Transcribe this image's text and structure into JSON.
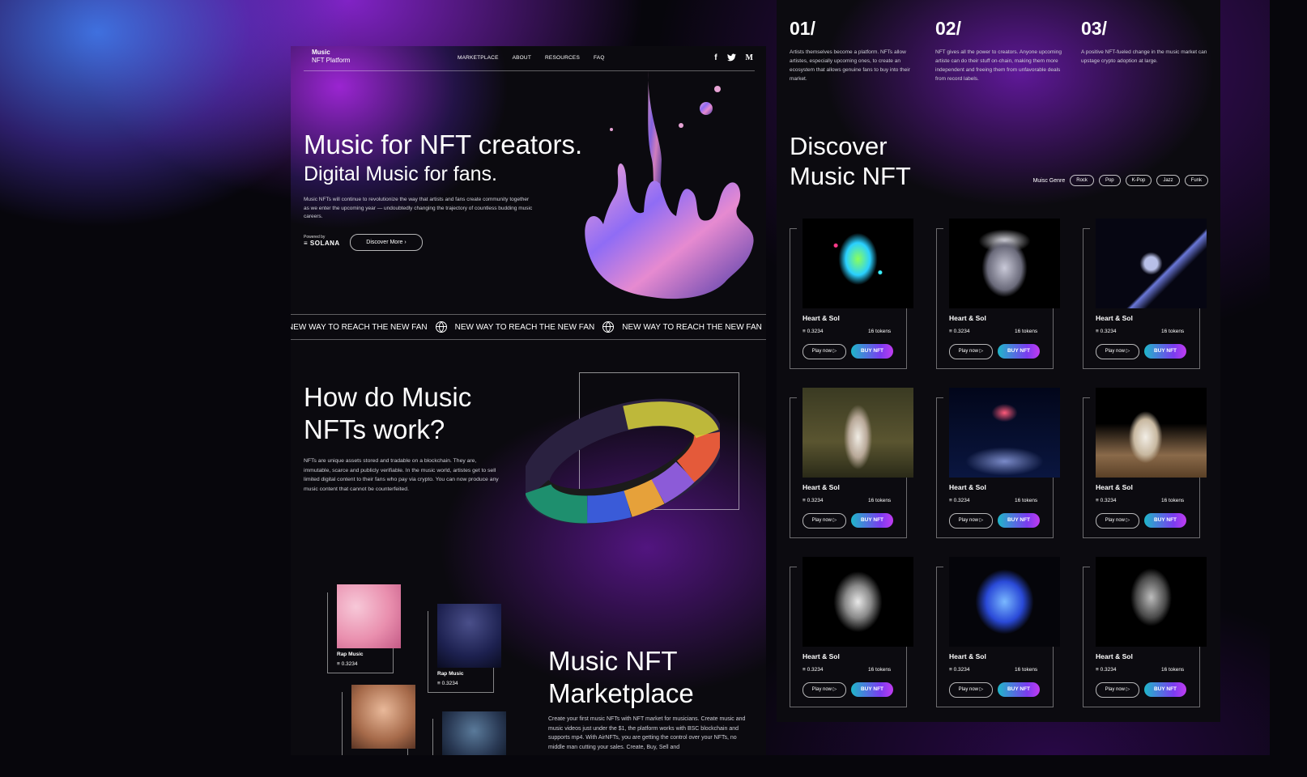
{
  "nav": {
    "logo_line1": "Music",
    "logo_line2": "NFT Platform",
    "links": [
      "MARKETPLACE",
      "ABOUT",
      "RESOURCES",
      "FAQ"
    ],
    "socials": [
      "f",
      "t",
      "M"
    ],
    "social_icons": [
      "facebook-icon",
      "twitter-icon",
      "medium-icon"
    ]
  },
  "hero": {
    "title": "Music for NFT creators.",
    "subtitle": "Digital Music for fans.",
    "description": "Music NFTs will continue to revolutionize the way that artists and fans create community together as we enter the upcoming year — undoubtedly changing the trajectory of countless budding music careers.",
    "powered_by": "Powered by",
    "solana": "≡ SOLANA",
    "cta": "Discover More  ›"
  },
  "marquee": {
    "text": "NEW WAY TO REACH THE NEW FAN"
  },
  "how": {
    "title": "How do Music NFTs work?",
    "description": "NFTs are unique assets stored and tradable on a blockchain. They are, immutable, scarce and publicly verifiable. In the music world, artistes get to sell limited digital content to their fans who pay via crypto. You can now produce any music content that cannot be counterfeited."
  },
  "artists": [
    {
      "name": "Rap Music",
      "price": "≡ 0.3234"
    },
    {
      "name": "Rap Music",
      "price": "≡ 0.3234"
    }
  ],
  "marketplace": {
    "title_line1": "Music NFT",
    "title_line2": "Marketplace",
    "description": "Create your first music NFTs with NFT market for musicians. Create music and music videos just under the $1, the platform works with BSC blockchain and supports mp4. With AirNFTs, you are getting the control over your NFTs, no middle man cutting your sales. Create, Buy, Sell and"
  },
  "steps": [
    {
      "num": "01/",
      "text": "Artists themselves become a platform. NFTs allow artistes, especially upcoming ones, to create an ecosystem that allows genuine fans to buy into their market."
    },
    {
      "num": "02/",
      "text": "NFT gives all the power to creators. Anyone upcoming artiste can do their stuff on-chain, making them more independent and freeing them from unfavorable deals from record labels."
    },
    {
      "num": "03/",
      "text": "A positive NFT-fueled change in the music market can upstage crypto adoption at large."
    }
  ],
  "discover": {
    "title_line1": "Discover",
    "title_line2": "Music NFT",
    "genre_label": "Muisc Genre",
    "genres": [
      "Rock",
      "Pop",
      "K-Pop",
      "Jazz",
      "Funk"
    ]
  },
  "nfts": [
    {
      "title": "Heart & Sol",
      "price": "≡ 0.3234",
      "tokens": "16 tokens",
      "play": "Play now ▷",
      "buy": "BUY NFT",
      "art": "astronaut-glitter"
    },
    {
      "title": "Heart & Sol",
      "price": "≡ 0.3234",
      "tokens": "16 tokens",
      "play": "Play now ▷",
      "buy": "BUY NFT",
      "art": "chrome-head-cap"
    },
    {
      "title": "Heart & Sol",
      "price": "≡ 0.3234",
      "tokens": "16 tokens",
      "play": "Play now ▷",
      "buy": "BUY NFT",
      "art": "hands-heart"
    },
    {
      "title": "Heart & Sol",
      "price": "≡ 0.3234",
      "tokens": "16 tokens",
      "play": "Play now ▷",
      "buy": "BUY NFT",
      "art": "astronaut-forest"
    },
    {
      "title": "Heart & Sol",
      "price": "≡ 0.3234",
      "tokens": "16 tokens",
      "play": "Play now ▷",
      "buy": "BUY NFT",
      "art": "floating-jellyfish"
    },
    {
      "title": "Heart & Sol",
      "price": "≡ 0.3234",
      "tokens": "16 tokens",
      "play": "Play now ▷",
      "buy": "BUY NFT",
      "art": "astronaut-chair"
    },
    {
      "title": "Heart & Sol",
      "price": "≡ 0.3234",
      "tokens": "16 tokens",
      "play": "Play now ▷",
      "buy": "BUY NFT",
      "art": "chrome-hand"
    },
    {
      "title": "Heart & Sol",
      "price": "≡ 0.3234",
      "tokens": "16 tokens",
      "play": "Play now ▷",
      "buy": "BUY NFT",
      "art": "blue-flower-bust"
    },
    {
      "title": "Heart & Sol",
      "price": "≡ 0.3234",
      "tokens": "16 tokens",
      "play": "Play now ▷",
      "buy": "BUY NFT",
      "art": "mesh-head"
    }
  ],
  "colors": {
    "accent_purple": "#7a3cf0",
    "accent_cyan": "#1fb7c9",
    "background": "#0b0a0f"
  }
}
